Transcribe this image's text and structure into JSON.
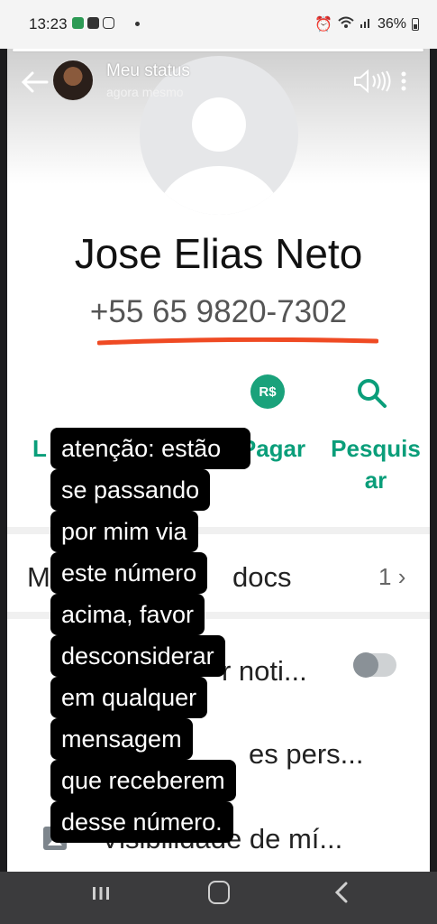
{
  "status_bar": {
    "time": "13:23",
    "battery": "36%"
  },
  "story": {
    "title": "Meu status",
    "subtitle": "agora mesmo"
  },
  "contact": {
    "name": "Jose Elias Neto",
    "phone": "+55 65 9820-7302"
  },
  "actions": {
    "pay_icon_label": "R$",
    "pay_label": "Pagar",
    "search_label_line1": "Pesquis",
    "search_label_line2": "ar",
    "partial_left_label": "L"
  },
  "rows": {
    "media_prefix": "M",
    "media_suffix": "docs",
    "media_count": "1",
    "notifications_partial": "r noti...",
    "custom_partial": "es pers...",
    "visibility": "Visibilidade de mí..."
  },
  "note": {
    "lines": [
      "atenção: estão",
      "se passando",
      "por mim via",
      "este número",
      "acima, favor",
      "desconsiderar",
      "em qualquer",
      "mensagem",
      "que receberem",
      "desse número."
    ]
  },
  "colors": {
    "accent": "#0a9e7a",
    "underline": "#ef4a23",
    "note_bg": "#000000"
  },
  "icons": {
    "back": "arrow-left-icon",
    "speaker": "speaker-icon",
    "search": "search-icon",
    "pay": "pay-icon",
    "gallery": "gallery-icon"
  }
}
